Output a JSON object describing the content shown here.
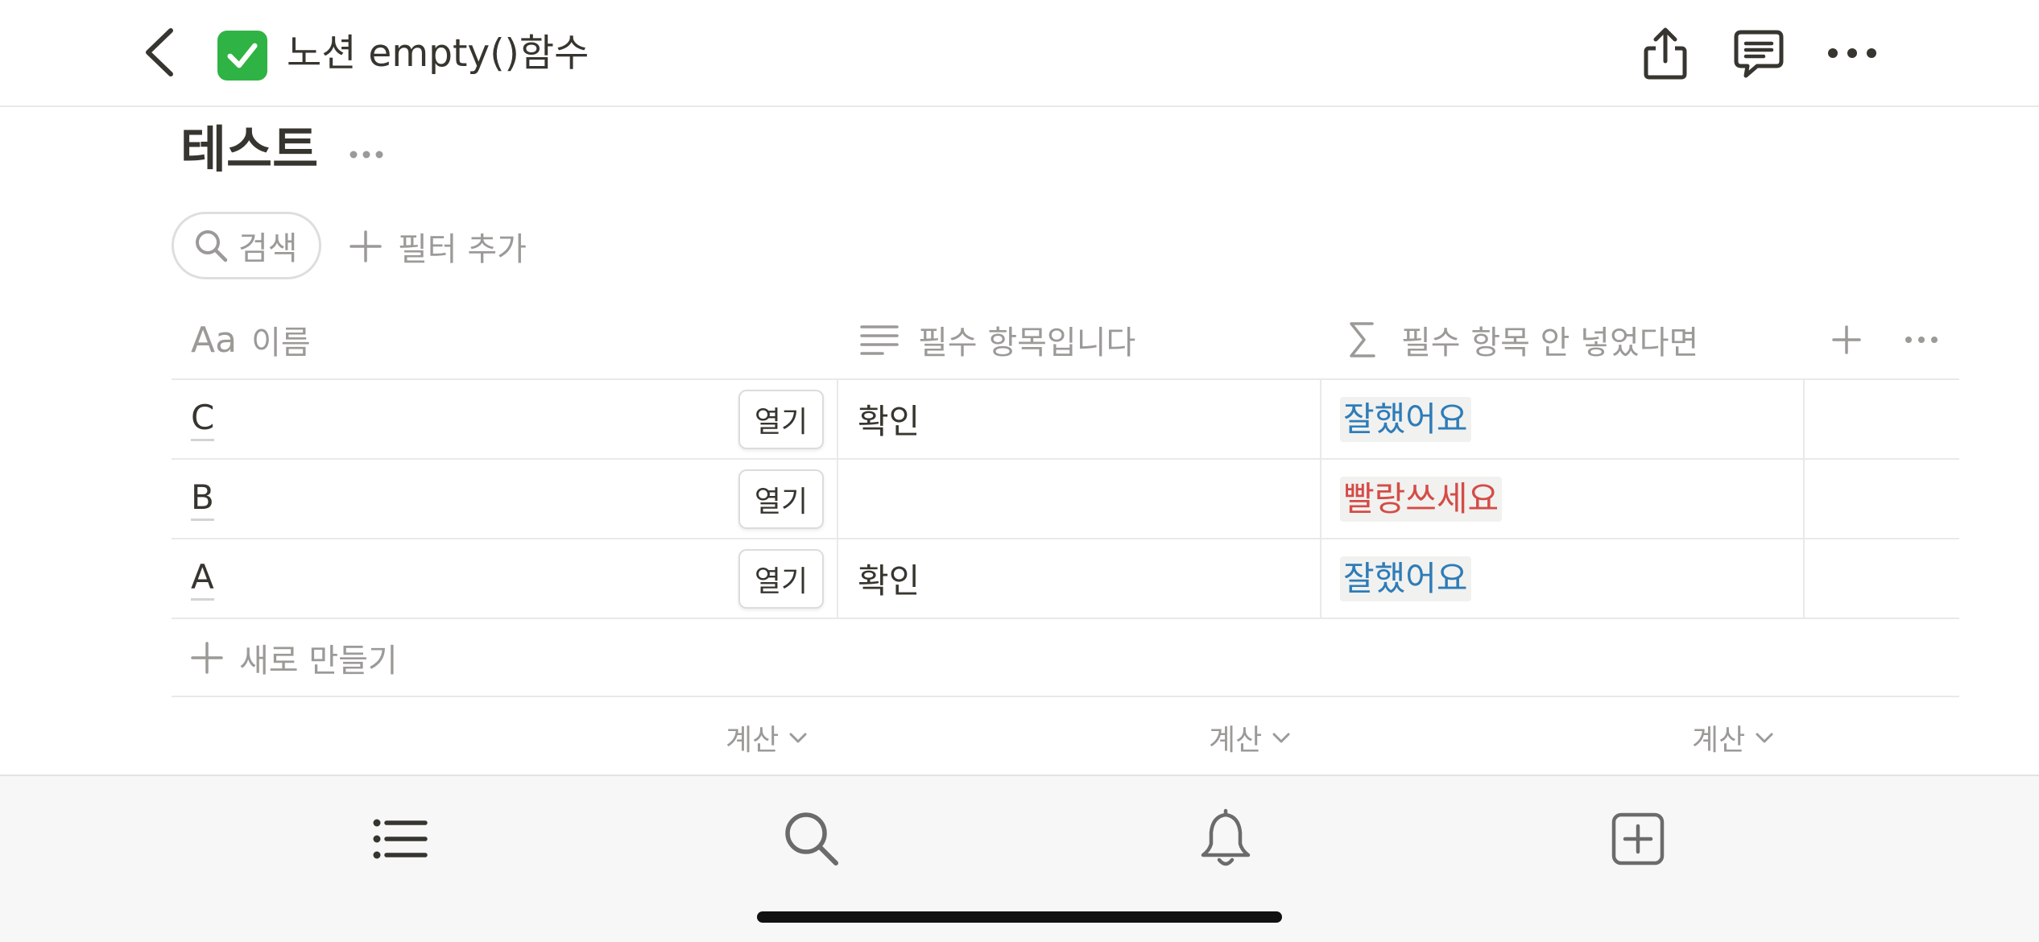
{
  "topbar": {
    "page_name": "노션 empty()함수",
    "page_icon": "check-mark-emoji",
    "icons": [
      "back-icon",
      "share-icon",
      "comment-icon",
      "more-icon"
    ]
  },
  "database": {
    "title": "테스트",
    "search_label": "검색",
    "add_filter_label": "필터 추가",
    "columns": [
      {
        "icon": "Aa",
        "label": "이름"
      },
      {
        "icon": "text-lines-icon",
        "label": "필수 항목입니다"
      },
      {
        "icon": "sigma-icon",
        "label": "필수 항목 안 넣었다면"
      }
    ],
    "rows": [
      {
        "name": "C",
        "open": "열기",
        "required": "확인",
        "formula": "잘했어요",
        "formula_color": "#2e7cb8"
      },
      {
        "name": "B",
        "open": "열기",
        "required": "",
        "formula": "빨랑쓰세요",
        "formula_color": "#d44c47"
      },
      {
        "name": "A",
        "open": "열기",
        "required": "확인",
        "formula": "잘했어요",
        "formula_color": "#2e7cb8"
      }
    ],
    "new_row_label": "새로 만들기",
    "calc_labels": [
      "계산",
      "계산",
      "계산"
    ]
  },
  "tabbar": {
    "icons": [
      "list-icon",
      "search-icon",
      "bell-icon",
      "new-page-icon"
    ]
  },
  "colors": {
    "text": "#37352f",
    "muted": "#9b9a97",
    "blue": "#2e7cb8",
    "red": "#d44c47",
    "emoji_green": "#2fb344"
  }
}
